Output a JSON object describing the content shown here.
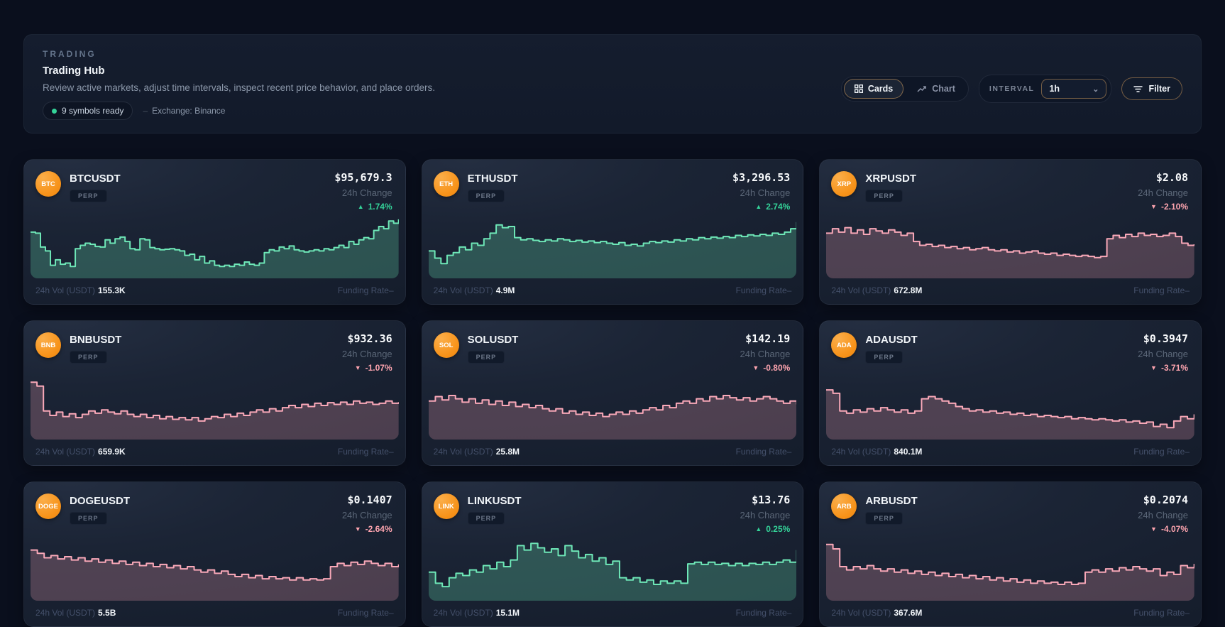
{
  "header": {
    "eyebrow": "TRADING",
    "title": "Trading Hub",
    "subtitle": "Review active markets, adjust time intervals, inspect recent price behavior, and place orders.",
    "status_pill": "9 symbols ready",
    "exchange_dash": "–",
    "exchange_label": "Exchange: Binance",
    "view_toggle": {
      "cards_label": "Cards",
      "chart_label": "Chart",
      "active": "Cards"
    },
    "interval": {
      "label": "INTERVAL",
      "value": "1h"
    },
    "filter_label": "Filter"
  },
  "labels": {
    "change": "24h Change",
    "volume": "24h Vol (USDT)",
    "funding": "Funding Rate",
    "funding_value": "–",
    "up_arrow": "▲",
    "down_arrow": "▼"
  },
  "colors": {
    "up": "#34d399",
    "down": "#fda4af",
    "spark_up_line": "#6ee7b7",
    "spark_up_fill": "rgba(110,231,183,0.26)",
    "spark_down_line": "#f9a8b8",
    "spark_down_fill": "rgba(249,168,184,0.24)",
    "accent_border": "#d69e5c"
  },
  "cards": [
    {
      "symbol": "BTCUSDT",
      "base": "BTC",
      "badge": "PERP",
      "price": "$95,679.3",
      "change": "1.74%",
      "direction": "up",
      "volume": "155.3K",
      "spark": [
        0.72,
        0.7,
        0.45,
        0.38,
        0.12,
        0.22,
        0.14,
        0.16,
        0.1,
        0.42,
        0.48,
        0.52,
        0.5,
        0.46,
        0.45,
        0.58,
        0.52,
        0.6,
        0.63,
        0.55,
        0.42,
        0.4,
        0.6,
        0.58,
        0.44,
        0.42,
        0.4,
        0.41,
        0.42,
        0.4,
        0.38,
        0.3,
        0.32,
        0.22,
        0.28,
        0.16,
        0.2,
        0.12,
        0.1,
        0.12,
        0.1,
        0.14,
        0.12,
        0.18,
        0.14,
        0.12,
        0.16,
        0.35,
        0.4,
        0.38,
        0.45,
        0.42,
        0.47,
        0.4,
        0.38,
        0.36,
        0.38,
        0.4,
        0.38,
        0.42,
        0.4,
        0.44,
        0.48,
        0.44,
        0.55,
        0.5,
        0.58,
        0.62,
        0.6,
        0.75,
        0.82,
        0.78,
        0.92,
        0.88,
        0.95
      ]
    },
    {
      "symbol": "ETHUSDT",
      "base": "ETH",
      "badge": "PERP",
      "price": "$3,296.53",
      "change": "2.74%",
      "direction": "up",
      "volume": "4.9M",
      "spark": [
        0.38,
        0.25,
        0.15,
        0.3,
        0.35,
        0.45,
        0.4,
        0.52,
        0.48,
        0.6,
        0.7,
        0.85,
        0.8,
        0.82,
        0.62,
        0.58,
        0.6,
        0.57,
        0.55,
        0.58,
        0.56,
        0.6,
        0.58,
        0.55,
        0.57,
        0.54,
        0.56,
        0.53,
        0.55,
        0.52,
        0.5,
        0.53,
        0.48,
        0.5,
        0.47,
        0.52,
        0.55,
        0.53,
        0.56,
        0.54,
        0.58,
        0.56,
        0.6,
        0.58,
        0.62,
        0.6,
        0.63,
        0.61,
        0.64,
        0.62,
        0.66,
        0.64,
        0.67,
        0.65,
        0.68,
        0.66,
        0.7,
        0.68,
        0.72,
        0.78,
        0.9
      ]
    },
    {
      "symbol": "XRPUSDT",
      "base": "XRP",
      "badge": "PERP",
      "price": "$2.08",
      "change": "-2.10%",
      "direction": "down",
      "volume": "672.8M",
      "spark": [
        0.7,
        0.78,
        0.72,
        0.8,
        0.7,
        0.76,
        0.68,
        0.78,
        0.74,
        0.7,
        0.76,
        0.72,
        0.66,
        0.7,
        0.55,
        0.48,
        0.5,
        0.46,
        0.48,
        0.44,
        0.46,
        0.42,
        0.44,
        0.4,
        0.42,
        0.44,
        0.4,
        0.38,
        0.4,
        0.36,
        0.38,
        0.34,
        0.36,
        0.38,
        0.34,
        0.32,
        0.34,
        0.3,
        0.32,
        0.3,
        0.28,
        0.3,
        0.28,
        0.26,
        0.28,
        0.6,
        0.66,
        0.62,
        0.68,
        0.64,
        0.7,
        0.66,
        0.68,
        0.64,
        0.66,
        0.7,
        0.64,
        0.52,
        0.48,
        0.5
      ]
    },
    {
      "symbol": "BNBUSDT",
      "base": "BNB",
      "badge": "PERP",
      "price": "$932.36",
      "change": "-1.07%",
      "direction": "down",
      "volume": "659.9K",
      "spark": [
        0.92,
        0.85,
        0.4,
        0.32,
        0.38,
        0.3,
        0.35,
        0.28,
        0.34,
        0.4,
        0.36,
        0.42,
        0.38,
        0.35,
        0.4,
        0.34,
        0.3,
        0.34,
        0.28,
        0.32,
        0.26,
        0.3,
        0.25,
        0.28,
        0.24,
        0.28,
        0.22,
        0.26,
        0.3,
        0.28,
        0.34,
        0.3,
        0.36,
        0.32,
        0.38,
        0.42,
        0.38,
        0.44,
        0.4,
        0.46,
        0.5,
        0.46,
        0.52,
        0.48,
        0.54,
        0.5,
        0.55,
        0.52,
        0.56,
        0.52,
        0.58,
        0.54,
        0.56,
        0.52,
        0.54,
        0.58,
        0.54,
        0.56
      ]
    },
    {
      "symbol": "SOLUSDT",
      "base": "SOL",
      "badge": "PERP",
      "price": "$142.19",
      "change": "-0.80%",
      "direction": "down",
      "volume": "25.8M",
      "spark": [
        0.58,
        0.66,
        0.6,
        0.68,
        0.62,
        0.56,
        0.62,
        0.54,
        0.6,
        0.52,
        0.58,
        0.5,
        0.56,
        0.48,
        0.52,
        0.46,
        0.5,
        0.44,
        0.4,
        0.44,
        0.36,
        0.4,
        0.34,
        0.38,
        0.32,
        0.36,
        0.3,
        0.34,
        0.38,
        0.34,
        0.4,
        0.36,
        0.42,
        0.46,
        0.42,
        0.5,
        0.46,
        0.54,
        0.58,
        0.54,
        0.62,
        0.58,
        0.66,
        0.62,
        0.68,
        0.64,
        0.6,
        0.64,
        0.58,
        0.62,
        0.66,
        0.62,
        0.58,
        0.54,
        0.58,
        0.52
      ]
    },
    {
      "symbol": "ADAUSDT",
      "base": "ADA",
      "badge": "PERP",
      "price": "$0.3947",
      "change": "-3.71%",
      "direction": "down",
      "volume": "840.1M",
      "spark": [
        0.78,
        0.72,
        0.4,
        0.36,
        0.42,
        0.38,
        0.44,
        0.4,
        0.46,
        0.42,
        0.38,
        0.42,
        0.36,
        0.4,
        0.62,
        0.66,
        0.62,
        0.58,
        0.54,
        0.48,
        0.44,
        0.4,
        0.42,
        0.38,
        0.4,
        0.36,
        0.38,
        0.34,
        0.36,
        0.32,
        0.34,
        0.3,
        0.32,
        0.3,
        0.28,
        0.3,
        0.26,
        0.28,
        0.26,
        0.24,
        0.26,
        0.24,
        0.22,
        0.24,
        0.2,
        0.22,
        0.18,
        0.2,
        0.12,
        0.16,
        0.1,
        0.22,
        0.3,
        0.26,
        0.34
      ]
    },
    {
      "symbol": "DOGEUSDT",
      "base": "DOGE",
      "badge": "PERP",
      "price": "$0.1407",
      "change": "-2.64%",
      "direction": "down",
      "volume": "5.5B",
      "spark": [
        0.8,
        0.74,
        0.66,
        0.7,
        0.64,
        0.68,
        0.62,
        0.66,
        0.6,
        0.64,
        0.58,
        0.62,
        0.56,
        0.6,
        0.54,
        0.58,
        0.52,
        0.56,
        0.5,
        0.54,
        0.48,
        0.52,
        0.46,
        0.5,
        0.44,
        0.4,
        0.44,
        0.38,
        0.42,
        0.36,
        0.32,
        0.36,
        0.3,
        0.34,
        0.28,
        0.32,
        0.28,
        0.3,
        0.26,
        0.3,
        0.26,
        0.28,
        0.26,
        0.28,
        0.5,
        0.56,
        0.52,
        0.58,
        0.54,
        0.6,
        0.56,
        0.52,
        0.56,
        0.5,
        0.54
      ]
    },
    {
      "symbol": "LINKUSDT",
      "base": "LINK",
      "badge": "PERP",
      "price": "$13.76",
      "change": "0.25%",
      "direction": "up",
      "volume": "15.1M",
      "spark": [
        0.4,
        0.2,
        0.14,
        0.3,
        0.38,
        0.34,
        0.44,
        0.4,
        0.52,
        0.46,
        0.58,
        0.5,
        0.62,
        0.88,
        0.8,
        0.92,
        0.84,
        0.76,
        0.82,
        0.7,
        0.88,
        0.78,
        0.66,
        0.72,
        0.6,
        0.66,
        0.54,
        0.6,
        0.3,
        0.26,
        0.3,
        0.22,
        0.26,
        0.18,
        0.24,
        0.2,
        0.24,
        0.2,
        0.55,
        0.58,
        0.54,
        0.58,
        0.54,
        0.56,
        0.52,
        0.56,
        0.52,
        0.56,
        0.54,
        0.58,
        0.54,
        0.58,
        0.62,
        0.58,
        0.8
      ]
    },
    {
      "symbol": "ARBUSDT",
      "base": "ARB",
      "badge": "PERP",
      "price": "$0.2074",
      "change": "-4.07%",
      "direction": "down",
      "volume": "367.6M",
      "spark": [
        0.9,
        0.82,
        0.5,
        0.44,
        0.5,
        0.46,
        0.52,
        0.46,
        0.42,
        0.46,
        0.4,
        0.44,
        0.38,
        0.42,
        0.36,
        0.4,
        0.34,
        0.38,
        0.32,
        0.36,
        0.3,
        0.34,
        0.28,
        0.32,
        0.26,
        0.3,
        0.24,
        0.28,
        0.22,
        0.26,
        0.2,
        0.24,
        0.2,
        0.22,
        0.18,
        0.22,
        0.18,
        0.2,
        0.4,
        0.44,
        0.4,
        0.46,
        0.42,
        0.48,
        0.44,
        0.5,
        0.46,
        0.42,
        0.46,
        0.34,
        0.4,
        0.36,
        0.52,
        0.48,
        0.55
      ]
    }
  ]
}
